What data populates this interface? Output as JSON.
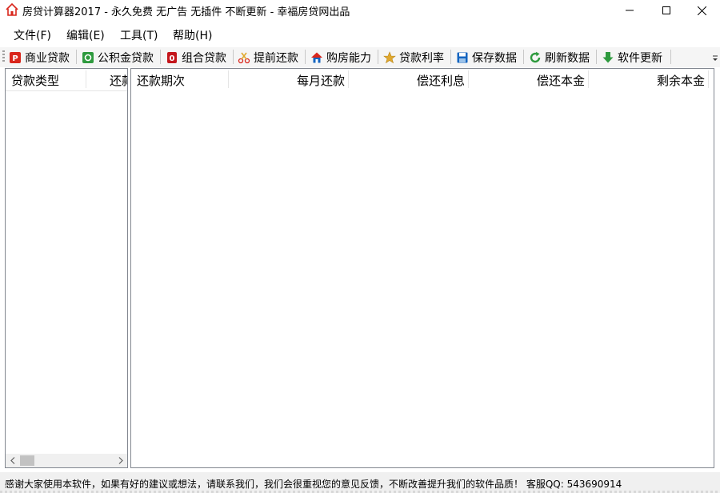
{
  "window": {
    "title": "房贷计算器2017 - 永久免费 无广告 无插件 不断更新 - 幸福房贷网出品",
    "icon": "house-icon",
    "controls": [
      "minimize-icon",
      "maximize-icon",
      "close-icon"
    ]
  },
  "menu": {
    "items": [
      {
        "label": "文件(F)"
      },
      {
        "label": "编辑(E)"
      },
      {
        "label": "工具(T)"
      },
      {
        "label": "帮助(H)"
      }
    ]
  },
  "toolbar": {
    "buttons": [
      {
        "label": "商业贷款",
        "icon": "commercial-loan-icon"
      },
      {
        "label": "公积金贷款",
        "icon": "provident-fund-icon"
      },
      {
        "label": "组合贷款",
        "icon": "combined-loan-icon"
      },
      {
        "label": "提前还款",
        "icon": "prepayment-icon"
      },
      {
        "label": "购房能力",
        "icon": "home-affordability-icon"
      },
      {
        "label": "贷款利率",
        "icon": "star-icon"
      },
      {
        "label": "保存数据",
        "icon": "save-icon"
      },
      {
        "label": "刷新数据",
        "icon": "refresh-icon"
      },
      {
        "label": "软件更新",
        "icon": "download-arrow-icon"
      }
    ]
  },
  "left_panel": {
    "columns": [
      "贷款类型",
      "还款"
    ]
  },
  "right_panel": {
    "columns": [
      "还款期次",
      "每月还款",
      "偿还利息",
      "偿还本金",
      "剩余本金"
    ]
  },
  "status": {
    "text": "感谢大家使用本软件，如果有好的建议或想法，请联系我们，我们会很重视您的意见反馈，不断改善提升我们的软件品质！ 客服QQ: 543690914"
  },
  "colors": {
    "red": "#d9261c",
    "green": "#2e9a3e",
    "blue": "#1565c0",
    "gold": "#e0a82e"
  }
}
